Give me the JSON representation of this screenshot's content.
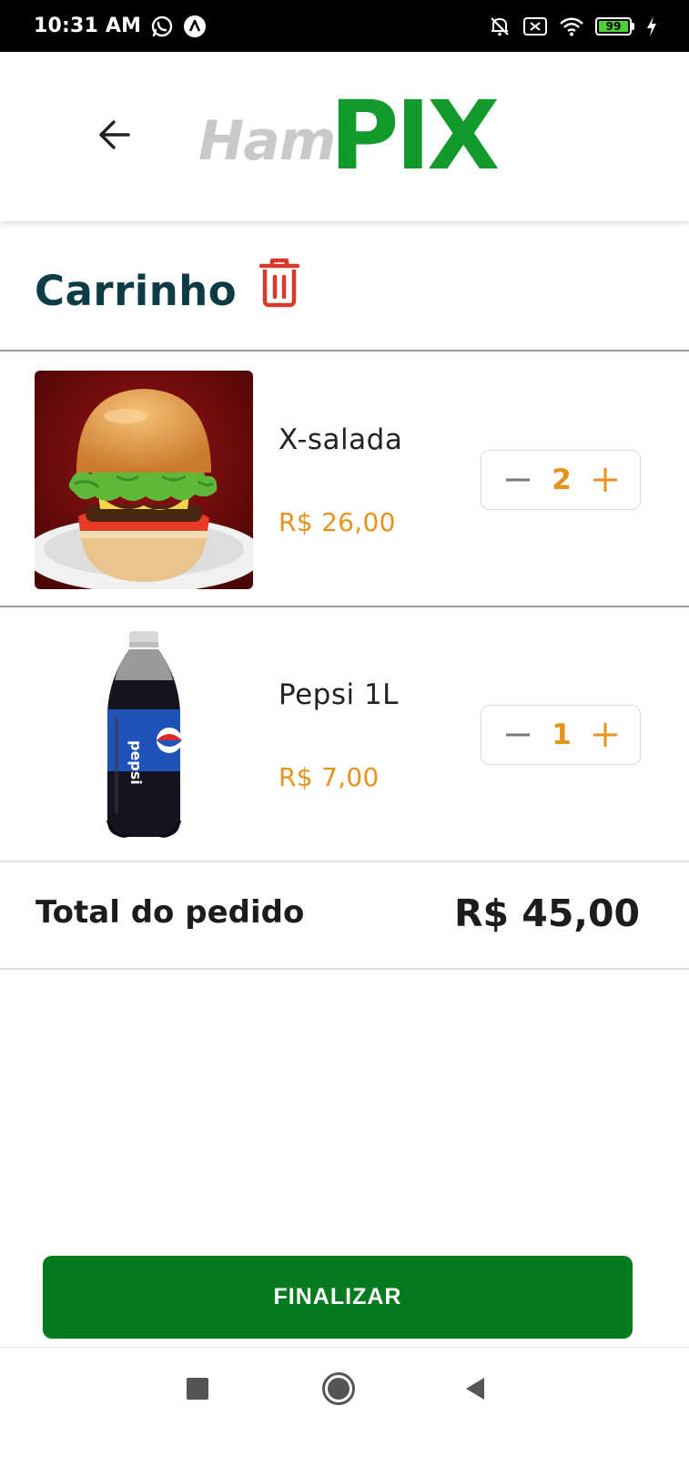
{
  "status_bar": {
    "time": "10:31 AM",
    "battery": "99",
    "icons": [
      "whatsapp-icon",
      "app-notification-icon",
      "mute-bell-icon",
      "sim-off-icon",
      "wifi-icon",
      "battery-icon",
      "charging-icon"
    ]
  },
  "header": {
    "logo_part1": "Ham",
    "logo_part2": "PIX",
    "logo_colors": {
      "ham": "#c9c9c9",
      "pix": "#129a2c"
    }
  },
  "cart": {
    "title": "Carrinho",
    "items": [
      {
        "name": "X-salada",
        "price": "R$ 26,00",
        "quantity": "2",
        "image": "burger"
      },
      {
        "name": "Pepsi 1L",
        "price": "R$ 7,00",
        "quantity": "1",
        "image": "pepsi-bottle"
      }
    ],
    "total_label": "Total do pedido",
    "total_value": "R$ 45,00"
  },
  "actions": {
    "finalize_label": "FINALIZAR"
  },
  "colors": {
    "title": "#0d3b46",
    "price": "#e8921b",
    "trash": "#d63a2b",
    "primary_button": "#067a1e"
  }
}
